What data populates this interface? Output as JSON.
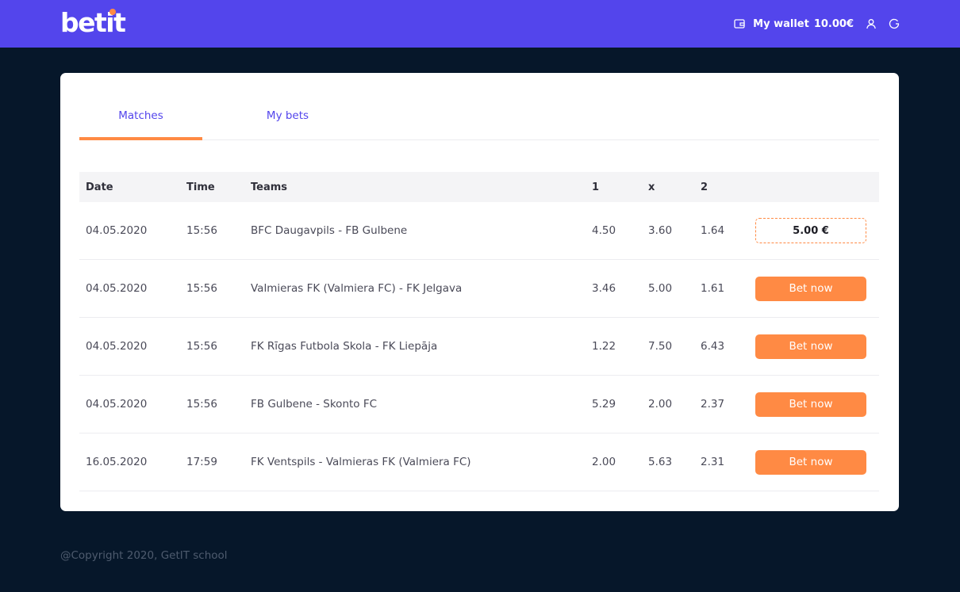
{
  "brand": {
    "logo_text": "betit"
  },
  "header": {
    "wallet_label": "My wallet",
    "wallet_amount": "10.00€"
  },
  "tabs": [
    {
      "label": "Matches",
      "active": true
    },
    {
      "label": "My bets",
      "active": false
    }
  ],
  "table": {
    "columns": [
      "Date",
      "Time",
      "Teams",
      "1",
      "x",
      "2"
    ],
    "rows": [
      {
        "date": "04.05.2020",
        "time": "15:56",
        "teams": "BFC Daugavpils - FB Gulbene",
        "o1": "4.50",
        "ox": "3.60",
        "o2": "1.64",
        "action": "stake",
        "stake_value": "5.00 €"
      },
      {
        "date": "04.05.2020",
        "time": "15:56",
        "teams": "Valmieras FK (Valmiera FC) - FK Jelgava",
        "o1": "3.46",
        "ox": "5.00",
        "o2": "1.61",
        "action": "Bet now"
      },
      {
        "date": "04.05.2020",
        "time": "15:56",
        "teams": "FK Rīgas Futbola Skola - FK Liepāja",
        "o1": "1.22",
        "ox": "7.50",
        "o2": "6.43",
        "action": "Bet now"
      },
      {
        "date": "04.05.2020",
        "time": "15:56",
        "teams": "FB Gulbene - Skonto FC",
        "o1": "5.29",
        "ox": "2.00",
        "o2": "2.37",
        "action": "Bet now"
      },
      {
        "date": "16.05.2020",
        "time": "17:59",
        "teams": "FK Ventspils - Valmieras FK (Valmiera FC)",
        "o1": "2.00",
        "ox": "5.63",
        "o2": "2.31",
        "action": "Bet now"
      }
    ]
  },
  "footer": {
    "copyright": "@Copyright 2020, GetIT school"
  },
  "colors": {
    "primary": "#5345ec",
    "accent": "#ff8a44",
    "background": "#06172a"
  },
  "icons": {
    "wallet": "wallet-icon",
    "user": "user-icon",
    "logout": "logout-icon"
  }
}
